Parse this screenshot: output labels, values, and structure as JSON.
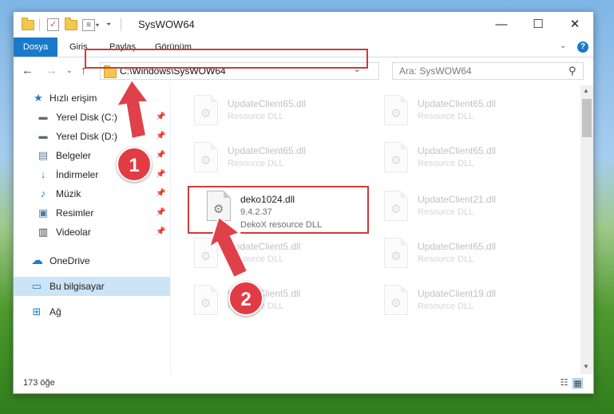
{
  "window": {
    "title": "SysWOW64",
    "minimize": "—",
    "maximize": "☐",
    "close": "✕"
  },
  "ribbon": {
    "tabs": [
      "Dosya",
      "Giriş",
      "Paylaş",
      "Görünüm"
    ],
    "collapse": "⌄",
    "help": "?"
  },
  "address_bar": {
    "path": "C:\\Windows\\SysWOW64",
    "search_placeholder": "Ara: SysWOW64"
  },
  "nav_pane": {
    "quick_access": "Hızlı erişim",
    "items": [
      {
        "label": "Yerel Disk (C:)",
        "icon": "drive-icon"
      },
      {
        "label": "Yerel Disk (D:)",
        "icon": "drive-icon"
      },
      {
        "label": "Belgeler",
        "icon": "documents-icon"
      },
      {
        "label": "İndirmeler",
        "icon": "downloads-icon"
      },
      {
        "label": "Müzik",
        "icon": "music-icon"
      },
      {
        "label": "Resimler",
        "icon": "pictures-icon"
      },
      {
        "label": "Videolar",
        "icon": "videos-icon"
      }
    ],
    "onedrive": "OneDrive",
    "this_pc": "Bu bilgisayar",
    "network": "Ağ"
  },
  "files": [
    {
      "name": "UpdateClient65.dll",
      "desc": "Resource DLL"
    },
    {
      "name": "UpdateClient65.dll",
      "desc": "Resource DLL"
    },
    {
      "name": "UpdateClient65.dll",
      "desc": "Resource DLL"
    },
    {
      "name": "UpdateClient65.dll",
      "desc": "Resource DLL"
    },
    {
      "name": "deko1024.dll",
      "version": "9.4.2.37",
      "desc": "DekoX resource DLL"
    },
    {
      "name": "UpdateClient21.dll",
      "desc": "Resource DLL"
    },
    {
      "name": "UpdateClient5.dll",
      "desc": "Resource DLL"
    },
    {
      "name": "UpdateClient65.dll",
      "desc": "Resource DLL"
    },
    {
      "name": "UpdateClient5.dll",
      "desc": "Resource DLL"
    },
    {
      "name": "UpdateClient19.dll",
      "desc": "Resource DLL"
    }
  ],
  "status": {
    "count": "173 öğe"
  },
  "callouts": [
    "1",
    "2"
  ],
  "colors": {
    "accent": "#1979ca",
    "highlight": "#d23a3a",
    "selection": "#cce4f7"
  }
}
